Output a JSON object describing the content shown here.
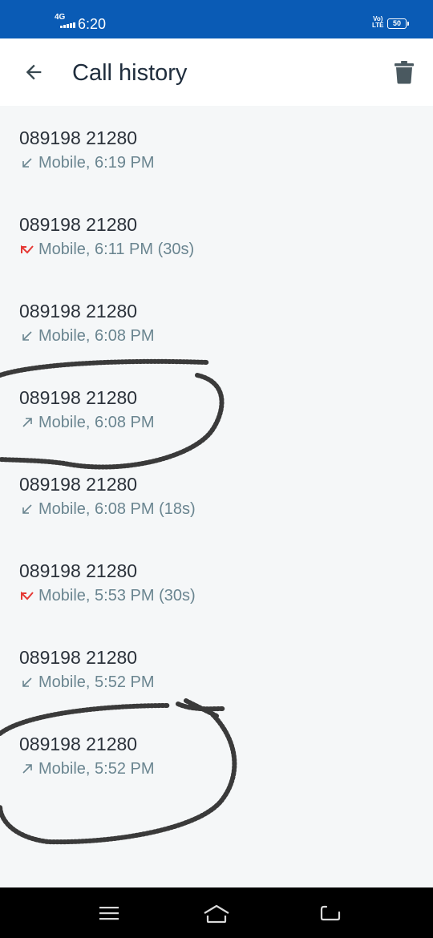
{
  "status_bar": {
    "network": "4G",
    "time": "6:20",
    "volte_top": "Vo)",
    "volte_bottom": "LTE",
    "battery": "50"
  },
  "header": {
    "title": "Call history",
    "back_icon": "arrow-left-icon",
    "delete_icon": "trash-icon"
  },
  "colors": {
    "status_bar": "#0a5bb5",
    "missed": "#e53935",
    "meta_text": "#6a8590",
    "number_text": "#2b323b"
  },
  "calls": [
    {
      "number": "089198 21280",
      "type": "incoming",
      "detail": "Mobile, 6:19 PM"
    },
    {
      "number": "089198 21280",
      "type": "missed",
      "detail": "Mobile, 6:11 PM (30s)"
    },
    {
      "number": "089198 21280",
      "type": "incoming",
      "detail": "Mobile, 6:08 PM"
    },
    {
      "number": "089198 21280",
      "type": "outgoing",
      "detail": "Mobile, 6:08 PM"
    },
    {
      "number": "089198 21280",
      "type": "incoming",
      "detail": "Mobile, 6:08 PM (18s)"
    },
    {
      "number": "089198 21280",
      "type": "missed",
      "detail": "Mobile, 5:53 PM (30s)"
    },
    {
      "number": "089198 21280",
      "type": "incoming",
      "detail": "Mobile, 5:52 PM"
    },
    {
      "number": "089198 21280",
      "type": "outgoing",
      "detail": "Mobile, 5:52 PM"
    }
  ],
  "nav_bar": {
    "recents_icon": "menu-icon",
    "home_icon": "home-icon",
    "back_icon": "back-icon"
  }
}
